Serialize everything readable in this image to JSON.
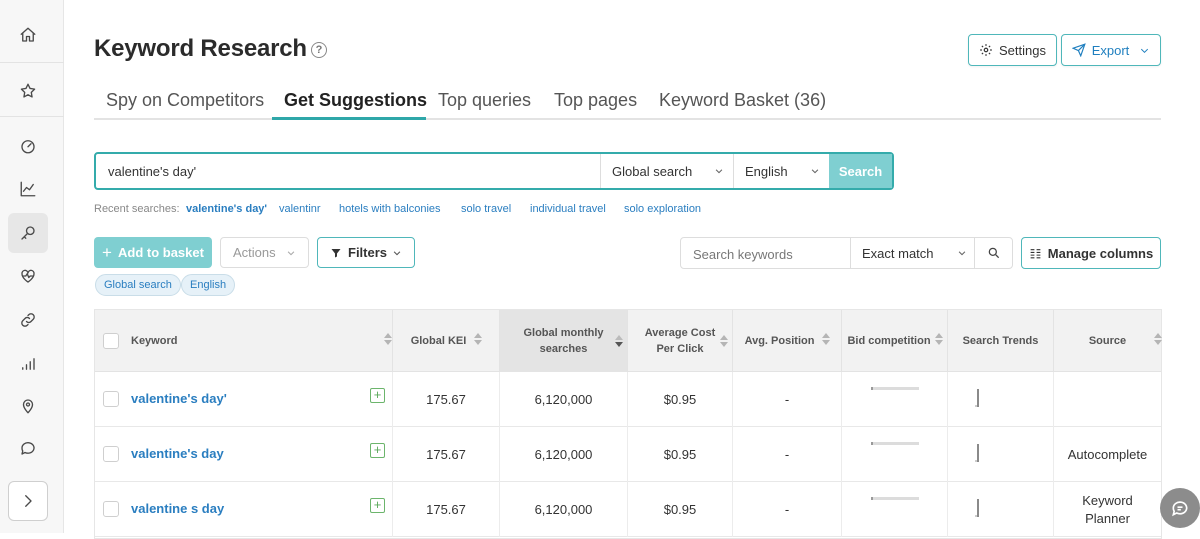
{
  "page": {
    "title": "Keyword Research",
    "settings_label": "Settings",
    "export_label": "Export"
  },
  "sidebar": [
    "home-icon",
    "star-icon",
    "dashboard-icon",
    "chart-icon",
    "key-icon",
    "heart-pulse-icon",
    "link-icon",
    "signal-icon",
    "pin-icon",
    "chat-icon",
    "expand-icon"
  ],
  "tabs": [
    {
      "label": "Spy on Competitors"
    },
    {
      "label": "Get Suggestions"
    },
    {
      "label": "Top queries"
    },
    {
      "label": "Top pages"
    },
    {
      "label": "Keyword Basket (36)"
    }
  ],
  "search": {
    "value": "valentine's day'",
    "scope": "Global search",
    "language": "English",
    "button": "Search"
  },
  "recent": {
    "label": "Recent searches:",
    "items": [
      "valentine's day'",
      "valentinr",
      "hotels with balconies",
      "solo travel",
      "individual travel",
      "solo exploration"
    ]
  },
  "toolbar": {
    "add_basket": "Add to basket",
    "actions": "Actions",
    "filters": "Filters",
    "kw_placeholder": "Search keywords",
    "match": "Exact match",
    "manage_columns": "Manage columns"
  },
  "chips": [
    "Global search",
    "English"
  ],
  "table": {
    "columns": {
      "keyword": "Keyword",
      "kei": "Global KEI",
      "monthly_1": "Global monthly",
      "monthly_2": "searches",
      "cpc_1": "Average Cost",
      "cpc_2": "Per Click",
      "position": "Avg. Position",
      "bid": "Bid competition",
      "trends": "Search Trends",
      "source": "Source"
    },
    "rows": [
      {
        "keyword": "valentine's day'",
        "kei": "175.67",
        "searches": "6,120,000",
        "cpc": "$0.95",
        "position": "-",
        "source_1": "",
        "source_2": ""
      },
      {
        "keyword": "valentine's day",
        "kei": "175.67",
        "searches": "6,120,000",
        "cpc": "$0.95",
        "position": "-",
        "source_1": "Autocomplete",
        "source_2": ""
      },
      {
        "keyword": "valentine s day",
        "kei": "175.67",
        "searches": "6,120,000",
        "cpc": "$0.95",
        "position": "-",
        "source_1": "Keyword",
        "source_2": "Planner"
      }
    ]
  },
  "colors": {
    "accent": "#2fa7a9",
    "button_fill": "#7fcfd1",
    "link": "#2a7ec0"
  }
}
